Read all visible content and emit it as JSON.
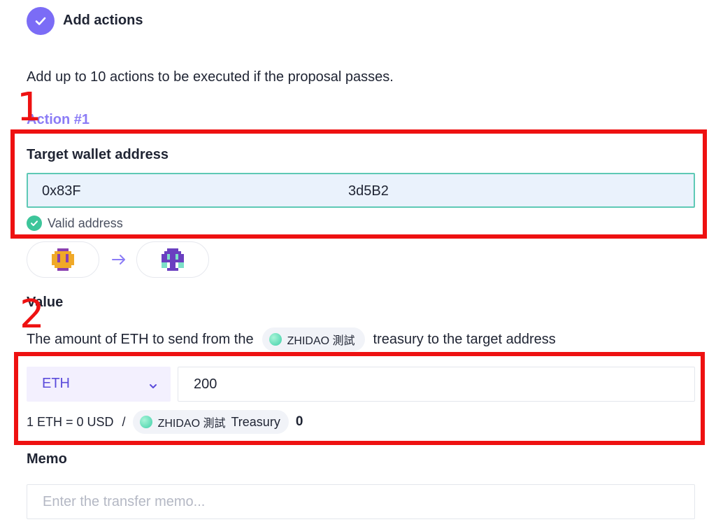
{
  "step": {
    "title": "Add actions"
  },
  "intro": "Add up to 10 actions to be executed if the proposal passes.",
  "action": {
    "label": "Action #1"
  },
  "annotations": {
    "box1": "1",
    "box2": "2",
    "color": "#ee1111"
  },
  "target": {
    "label": "Target wallet address",
    "value_start": "0x83F",
    "value_end": "3d5B2",
    "status": "Valid address"
  },
  "value": {
    "label": "Value",
    "desc_before": "The amount of ETH to send from the",
    "dao_name": "ZHIDAO 測試",
    "desc_after": "treasury to the target address",
    "token": "ETH",
    "amount": "200",
    "rate": "1 ETH = 0 USD",
    "separator": "/",
    "treasury_dao": "ZHIDAO 測試",
    "treasury_label": "Treasury",
    "treasury_balance": "0"
  },
  "memo": {
    "label": "Memo",
    "placeholder": "Enter the transfer memo..."
  },
  "colors": {
    "accent": "#7b6cf6",
    "valid": "#3dc59a",
    "input_border": "#5ec9b5",
    "select_bg": "#f3f0fe"
  }
}
